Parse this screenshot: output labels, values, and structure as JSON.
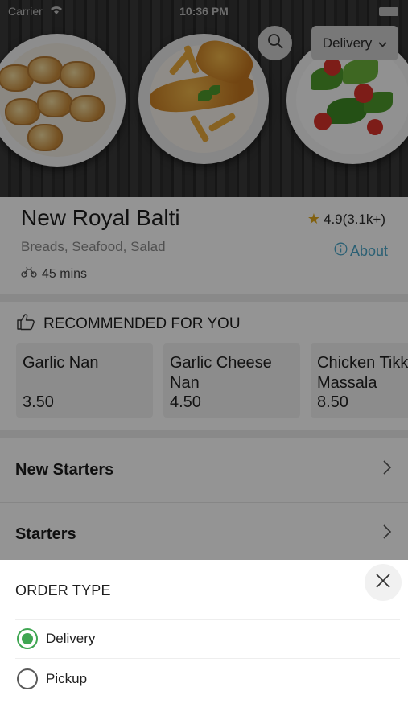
{
  "status_bar": {
    "carrier": "Carrier",
    "time": "10:36 PM"
  },
  "header": {
    "order_mode": "Delivery",
    "search_icon": "search-icon",
    "chevron_icon": "chevron-down-icon"
  },
  "restaurant": {
    "name": "New Royal Balti",
    "rating": "4.9(3.1k+)",
    "cuisine": "Breads, Seafood, Salad",
    "about_label": "About",
    "delivery_time": "45 mins"
  },
  "recommended": {
    "title": "RECOMMENDED FOR YOU",
    "items": [
      {
        "name": "Garlic Nan",
        "price": "3.50"
      },
      {
        "name": "Garlic Cheese Nan",
        "price": "4.50"
      },
      {
        "name": "Chicken Tikka Massala",
        "price": "8.50"
      }
    ]
  },
  "categories": [
    {
      "label": "New Starters"
    },
    {
      "label": "Starters"
    }
  ],
  "order_type_sheet": {
    "title": "ORDER TYPE",
    "options": [
      {
        "label": "Delivery",
        "selected": true
      },
      {
        "label": "Pickup",
        "selected": false
      }
    ]
  },
  "colors": {
    "accent_green": "#3fa652",
    "link_blue": "#4aa6c8",
    "star": "#e0a81c"
  }
}
